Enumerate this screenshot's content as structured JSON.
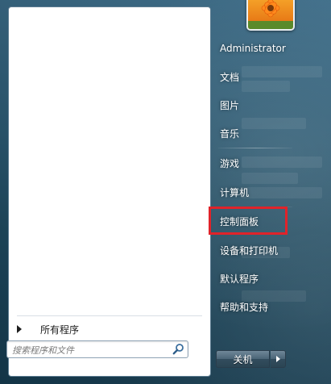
{
  "right_menu": {
    "items": [
      {
        "label": "Administrator"
      },
      {
        "label": "文档"
      },
      {
        "label": "图片"
      },
      {
        "label": "音乐"
      },
      {
        "label": "游戏"
      },
      {
        "label": "计算机"
      },
      {
        "label": "控制面板"
      },
      {
        "label": "设备和打印机"
      },
      {
        "label": "默认程序"
      },
      {
        "label": "帮助和支持"
      }
    ]
  },
  "left_pane": {
    "all_programs_label": "所有程序",
    "search": {
      "placeholder": "搜索程序和文件",
      "value": ""
    }
  },
  "power": {
    "shutdown_label": "关机"
  },
  "icons": {
    "search": "search-icon",
    "avatar": "user-avatar-flower",
    "all_programs_arrow": "right-triangle-icon",
    "shutdown_options": "right-triangle-icon"
  },
  "colors": {
    "highlight_border": "#e0232a",
    "accent": "#2c5a73"
  }
}
